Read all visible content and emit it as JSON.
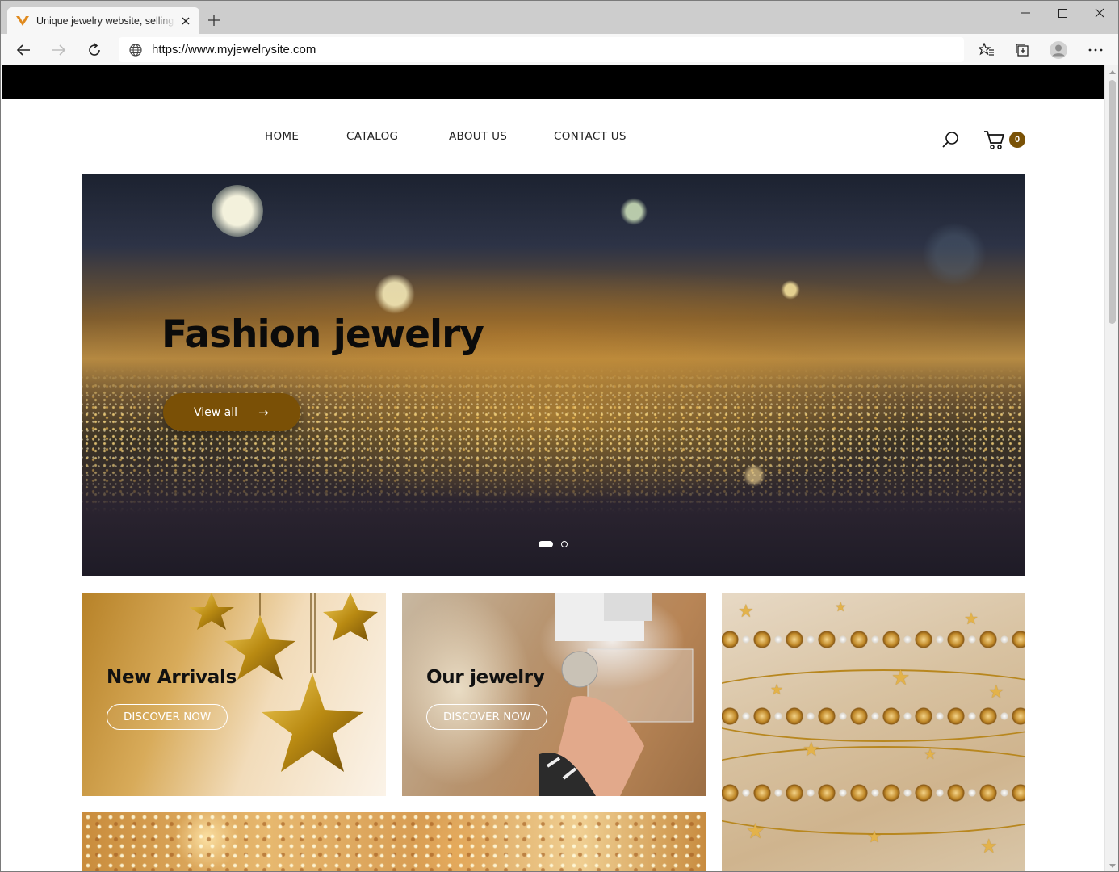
{
  "browser": {
    "tab_title": "Unique jewelry website, selling jewelry",
    "url": "https://www.myjewelrysite.com",
    "icons": {
      "favicon": "favicon-v-icon",
      "close_tab": "close-icon",
      "new_tab": "plus-icon",
      "back": "back-arrow-icon",
      "forward": "forward-arrow-icon",
      "refresh": "refresh-icon",
      "site_info": "globe-icon",
      "favorites": "favorites-icon",
      "collections": "collections-icon",
      "profile": "profile-icon",
      "menu": "more-icon",
      "minimize": "minimize-icon",
      "maximize": "maximize-icon",
      "close_window": "close-icon"
    }
  },
  "site": {
    "nav": [
      {
        "label": "HOME"
      },
      {
        "label": "CATALOG"
      },
      {
        "label": "ABOUT US"
      },
      {
        "label": "CONTACT US"
      }
    ],
    "cart_count": "0",
    "accent_color": "#7a5206",
    "hero": {
      "title": "Fashion jewelry",
      "button_label": "View all",
      "button_arrow": "→",
      "slides_total": 2,
      "active_slide": 1
    },
    "tiles": [
      {
        "title": "New Arrivals",
        "button": "DISCOVER NOW"
      },
      {
        "title": "Our jewelry",
        "button": "DISCOVER NOW"
      }
    ]
  }
}
